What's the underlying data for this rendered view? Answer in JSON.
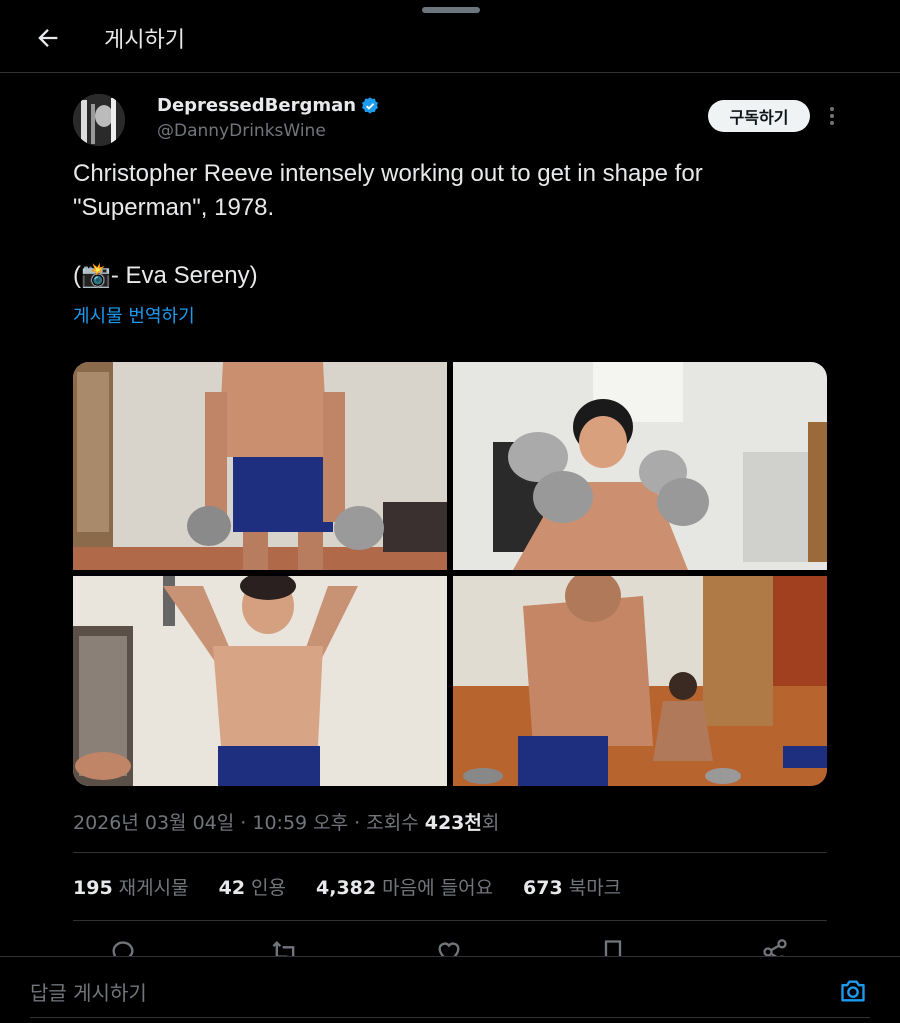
{
  "header": {
    "title": "게시하기"
  },
  "author": {
    "name": "DepressedBergman",
    "handle": "@DannyDrinksWine",
    "verified": true
  },
  "subscribe_label": "구독하기",
  "tweet": {
    "line1": "Christopher Reeve intensely working out to get in shape for",
    "line2": "\"Superman\", 1978.",
    "line3_prefix": "(",
    "line3_emoji": "📸",
    "line3_suffix": "- Eva Sereny)"
  },
  "translate_label": "게시물 번역하기",
  "meta": {
    "date": "2026년 03월 04일",
    "sep1": " · ",
    "time": "10:59 오후",
    "sep2": " · ",
    "views_label": "조회수 ",
    "views_value": "423천",
    "views_suffix": "회"
  },
  "stats": [
    {
      "value": "195",
      "label": "재게시물"
    },
    {
      "value": "42",
      "label": "인용"
    },
    {
      "value": "4,382",
      "label": "마음에 들어요"
    },
    {
      "value": "673",
      "label": "북마크"
    }
  ],
  "reply": {
    "placeholder": "답글 게시하기"
  },
  "colors": {
    "accent": "#1d9bf0",
    "background": "#000000",
    "muted": "#71767b"
  },
  "icons": [
    "back-arrow-icon",
    "verified-badge-icon",
    "more-icon",
    "reply-icon",
    "repost-icon",
    "like-icon",
    "bookmark-icon",
    "share-icon",
    "camera-icon"
  ]
}
